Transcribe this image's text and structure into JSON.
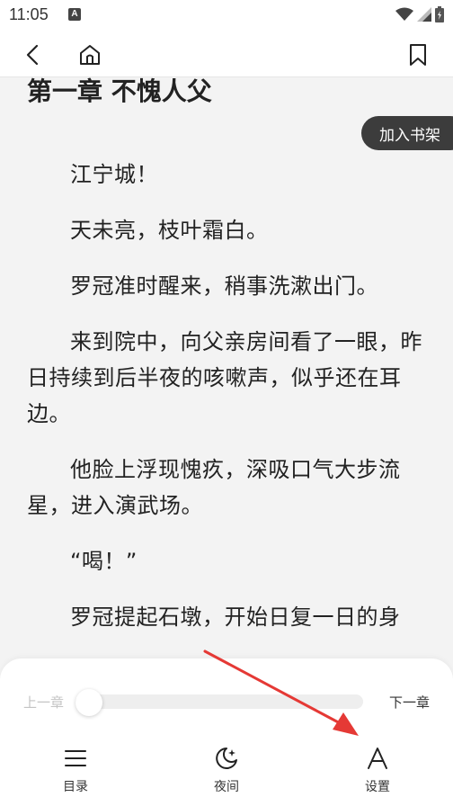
{
  "status_bar": {
    "time": "11:05",
    "badge": "A",
    "icons": [
      "wifi-icon",
      "signal-icon",
      "battery-icon"
    ]
  },
  "nav": {
    "icons": [
      "back-icon",
      "home-icon",
      "bookmark-icon"
    ]
  },
  "reader": {
    "chapter_title": "第一章 不愧人父",
    "shelf_button": "加入书架",
    "paragraphs": [
      "江宁城！",
      "天未亮，枝叶霜白。",
      "罗冠准时醒来，稍事洗漱出门。",
      "来到院中，向父亲房间看了一眼，昨日持续到后半夜的咳嗽声，似乎还在耳边。",
      "他脸上浮现愧疚，深吸口气大步流星，进入演武场。",
      "“喝！”",
      "罗冠提起石墩，开始日复一日的身"
    ]
  },
  "bottom_panel": {
    "prev_chapter": "上一章",
    "next_chapter": "下一章",
    "progress": 0,
    "tabs": [
      {
        "label": "目录",
        "icon": "menu-icon"
      },
      {
        "label": "夜间",
        "icon": "moon-icon"
      },
      {
        "label": "设置",
        "icon": "font-icon"
      }
    ]
  },
  "colors": {
    "background": "#f3f3f3",
    "shelf_button_bg": "#3c3c3c",
    "annotation_arrow": "#e53935"
  }
}
